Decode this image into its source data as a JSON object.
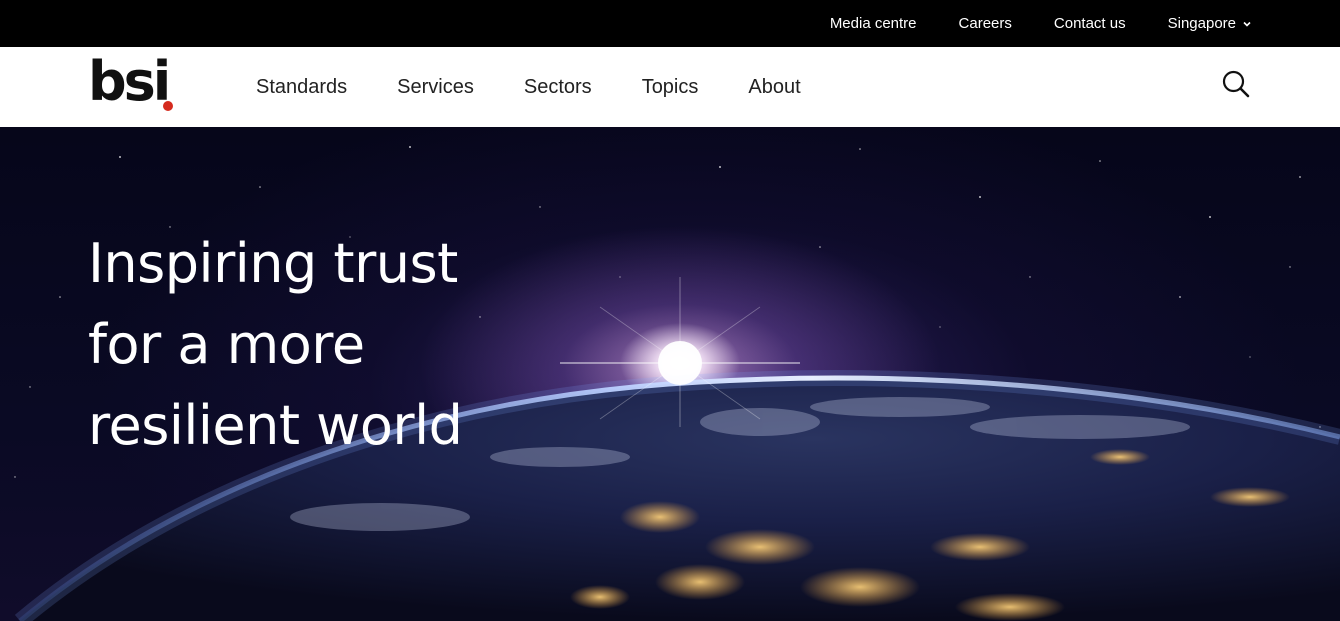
{
  "utility_nav": {
    "items": [
      {
        "label": "Media centre"
      },
      {
        "label": "Careers"
      },
      {
        "label": "Contact us"
      },
      {
        "label": "Singapore"
      }
    ]
  },
  "header": {
    "logo_text": "bsi",
    "logo_dot_color": "#d52b1e",
    "nav": [
      {
        "label": "Standards"
      },
      {
        "label": "Services"
      },
      {
        "label": "Sectors"
      },
      {
        "label": "Topics"
      },
      {
        "label": "About"
      }
    ],
    "search_icon": "search-icon"
  },
  "hero": {
    "title_lines": [
      "Inspiring trust",
      "for a more",
      "resilient world"
    ],
    "background": "earth-from-space-image"
  }
}
